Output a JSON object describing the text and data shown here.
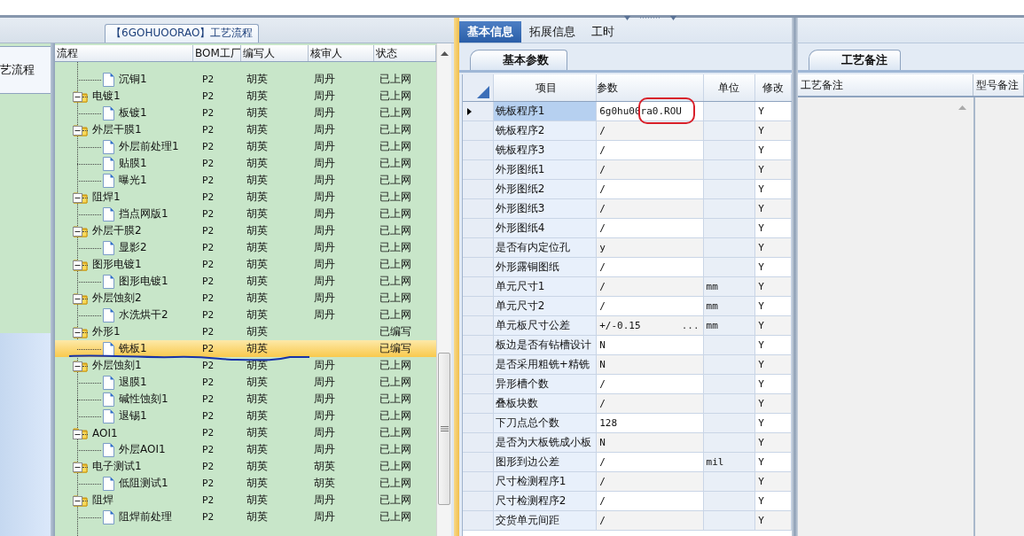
{
  "top_tab": {
    "label": "【6GOHUOORAO】工艺流程"
  },
  "side_panel": {
    "title": "艺流程"
  },
  "flow_grid": {
    "columns": [
      "流程",
      "BOM工厂",
      "编写人",
      "核审人",
      "状态"
    ],
    "nodes": [
      {
        "children": [
          {
            "name": "沉铜1",
            "kind": "file",
            "factory": "P2",
            "writer": "胡英",
            "reviewer": "周丹",
            "status": "已上网",
            "selected": false
          }
        ]
      },
      {
        "name": "电镀1",
        "kind": "folder",
        "expanded": true,
        "factory": "P2",
        "writer": "胡英",
        "reviewer": "周丹",
        "status": "已上网",
        "selected": false,
        "children": [
          {
            "name": "板镀1",
            "kind": "file",
            "factory": "P2",
            "writer": "胡英",
            "reviewer": "周丹",
            "status": "已上网",
            "selected": false
          }
        ]
      },
      {
        "name": "外层干膜1",
        "kind": "folder",
        "expanded": true,
        "factory": "P2",
        "writer": "胡英",
        "reviewer": "周丹",
        "status": "已上网",
        "selected": false,
        "children": [
          {
            "name": "外层前处理1",
            "kind": "file",
            "factory": "P2",
            "writer": "胡英",
            "reviewer": "周丹",
            "status": "已上网",
            "selected": false
          },
          {
            "name": "贴膜1",
            "kind": "file",
            "factory": "P2",
            "writer": "胡英",
            "reviewer": "周丹",
            "status": "已上网",
            "selected": false
          },
          {
            "name": "曝光1",
            "kind": "file",
            "factory": "P2",
            "writer": "胡英",
            "reviewer": "周丹",
            "status": "已上网",
            "selected": false
          }
        ]
      },
      {
        "name": "阻焊1",
        "kind": "folder",
        "expanded": true,
        "factory": "P2",
        "writer": "胡英",
        "reviewer": "周丹",
        "status": "已上网",
        "selected": false,
        "children": [
          {
            "name": "挡点网版1",
            "kind": "file",
            "factory": "P2",
            "writer": "胡英",
            "reviewer": "周丹",
            "status": "已上网",
            "selected": false
          }
        ]
      },
      {
        "name": "外层干膜2",
        "kind": "folder",
        "expanded": true,
        "factory": "P2",
        "writer": "胡英",
        "reviewer": "周丹",
        "status": "已上网",
        "selected": false,
        "children": [
          {
            "name": "显影2",
            "kind": "file",
            "factory": "P2",
            "writer": "胡英",
            "reviewer": "周丹",
            "status": "已上网",
            "selected": false
          }
        ]
      },
      {
        "name": "图形电镀1",
        "kind": "folder",
        "expanded": true,
        "factory": "P2",
        "writer": "胡英",
        "reviewer": "周丹",
        "status": "已上网",
        "selected": false,
        "children": [
          {
            "name": "图形电镀1",
            "kind": "file",
            "factory": "P2",
            "writer": "胡英",
            "reviewer": "周丹",
            "status": "已上网",
            "selected": false
          }
        ]
      },
      {
        "name": "外层蚀刻2",
        "kind": "folder",
        "expanded": true,
        "factory": "P2",
        "writer": "胡英",
        "reviewer": "周丹",
        "status": "已上网",
        "selected": false,
        "children": [
          {
            "name": "水洗烘干2",
            "kind": "file",
            "factory": "P2",
            "writer": "胡英",
            "reviewer": "周丹",
            "status": "已上网",
            "selected": false
          }
        ]
      },
      {
        "name": "外形1",
        "kind": "folder",
        "expanded": true,
        "factory": "P2",
        "writer": "胡英",
        "status": "已编写",
        "selected": false,
        "children": [
          {
            "name": "铣板1",
            "kind": "file",
            "factory": "P2",
            "writer": "胡英",
            "status": "已编写",
            "selected": true
          }
        ]
      },
      {
        "name": "外层蚀刻1",
        "kind": "folder",
        "expanded": true,
        "factory": "P2",
        "writer": "胡英",
        "reviewer": "周丹",
        "status": "已上网",
        "selected": false,
        "children": [
          {
            "name": "退膜1",
            "kind": "file",
            "factory": "P2",
            "writer": "胡英",
            "reviewer": "周丹",
            "status": "已上网",
            "selected": false
          },
          {
            "name": "碱性蚀刻1",
            "kind": "file",
            "factory": "P2",
            "writer": "胡英",
            "reviewer": "周丹",
            "status": "已上网",
            "selected": false
          },
          {
            "name": "退锡1",
            "kind": "file",
            "factory": "P2",
            "writer": "胡英",
            "reviewer": "周丹",
            "status": "已上网",
            "selected": false
          }
        ]
      },
      {
        "name": "AOI1",
        "kind": "folder",
        "expanded": true,
        "factory": "P2",
        "writer": "胡英",
        "reviewer": "周丹",
        "status": "已上网",
        "selected": false,
        "children": [
          {
            "name": "外层AOI1",
            "kind": "file",
            "factory": "P2",
            "writer": "胡英",
            "reviewer": "周丹",
            "status": "已上网",
            "selected": false
          }
        ]
      },
      {
        "name": "电子测试1",
        "kind": "folder",
        "expanded": true,
        "factory": "P2",
        "writer": "胡英",
        "reviewer": "胡英",
        "status": "已上网",
        "selected": false,
        "children": [
          {
            "name": "低阻测试1",
            "kind": "file",
            "factory": "P2",
            "writer": "胡英",
            "reviewer": "胡英",
            "status": "已上网",
            "selected": false
          }
        ]
      },
      {
        "name": "阻焊",
        "kind": "folder",
        "expanded": true,
        "factory": "P2",
        "writer": "胡英",
        "reviewer": "周丹",
        "status": "已上网",
        "selected": false,
        "children": [
          {
            "name": "阻焊前处理",
            "kind": "file",
            "factory": "P2",
            "writer": "胡英",
            "reviewer": "周丹",
            "status": "已上网",
            "selected": false
          }
        ]
      }
    ]
  },
  "info_tabs": [
    {
      "label": "基本信息",
      "selected": true
    },
    {
      "label": "拓展信息",
      "selected": false
    },
    {
      "label": "工时",
      "selected": false
    }
  ],
  "param_tab": {
    "label": "基本参数"
  },
  "param_grid": {
    "columns": [
      "项目",
      "参数",
      "单位",
      "修改"
    ],
    "rows": [
      {
        "item": "铣板程序1",
        "value": "6g0hu00ra0.ROU",
        "modify": "Y",
        "selected": true
      },
      {
        "item": "铣板程序2",
        "value": "/",
        "modify": "Y",
        "selected": false
      },
      {
        "item": "铣板程序3",
        "value": "/",
        "modify": "Y",
        "selected": false
      },
      {
        "item": "外形图纸1",
        "value": "/",
        "modify": "Y",
        "selected": false
      },
      {
        "item": "外形图纸2",
        "value": "/",
        "modify": "Y",
        "selected": false
      },
      {
        "item": "外形图纸3",
        "value": "/",
        "modify": "Y",
        "selected": false
      },
      {
        "item": "外形图纸4",
        "value": "/",
        "modify": "Y",
        "selected": false
      },
      {
        "item": "是否有内定位孔",
        "value": "y",
        "modify": "Y",
        "selected": false
      },
      {
        "item": "外形露铜图纸",
        "value": "/",
        "modify": "Y",
        "selected": false
      },
      {
        "item": "单元尺寸1",
        "value": "/",
        "unit": "mm",
        "modify": "Y",
        "selected": false
      },
      {
        "item": "单元尺寸2",
        "value": "/",
        "unit": "mm",
        "modify": "Y",
        "selected": false
      },
      {
        "item": "单元板尺寸公差",
        "value": "+/-0.15",
        "ellipsis_button": "...",
        "unit": "mm",
        "modify": "Y",
        "selected": false
      },
      {
        "item": "板边是否有钻槽设计",
        "value": "N",
        "modify": "Y",
        "selected": false
      },
      {
        "item": "是否采用粗铣+精铣",
        "value": "N",
        "modify": "Y",
        "selected": false
      },
      {
        "item": "异形槽个数",
        "value": "/",
        "modify": "Y",
        "selected": false
      },
      {
        "item": "叠板块数",
        "value": "/",
        "modify": "Y",
        "selected": false
      },
      {
        "item": "下刀点总个数",
        "value": "128",
        "modify": "Y",
        "selected": false
      },
      {
        "item": "是否为大板铣成小板",
        "value": "N",
        "modify": "Y",
        "selected": false
      },
      {
        "item": "图形到边公差",
        "value": "/",
        "unit": "mil",
        "modify": "Y",
        "selected": false
      },
      {
        "item": "尺寸检测程序1",
        "value": "/",
        "modify": "Y",
        "selected": false
      },
      {
        "item": "尺寸检测程序2",
        "value": "/",
        "modify": "Y",
        "selected": false
      },
      {
        "item": "交货单元间距",
        "value": "/",
        "modify": "Y",
        "selected": false
      }
    ]
  },
  "notes_tab": {
    "label": "工艺备注"
  },
  "notes_grid": {
    "columns": [
      "工艺备注",
      "型号备注"
    ]
  }
}
